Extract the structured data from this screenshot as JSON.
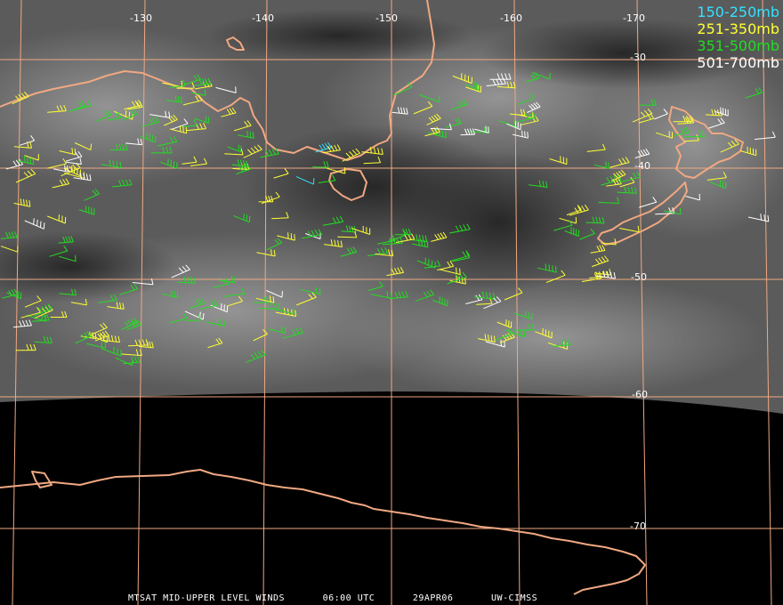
{
  "colors": {
    "graticule": "#f0a882",
    "coastline": "#f0a882",
    "background": "#000000",
    "imagery": "#5a5a5a"
  },
  "longitude_labels": [
    "-130",
    "-140",
    "-150",
    "-160",
    "-170"
  ],
  "latitude_labels": [
    "-30",
    "-40",
    "-50",
    "-60",
    "-70"
  ],
  "legend": [
    {
      "label": "150-250mb",
      "color": "#33e0ff"
    },
    {
      "label": "251-350mb",
      "color": "#ffff33"
    },
    {
      "label": "351-500mb",
      "color": "#22dd22"
    },
    {
      "label": "501-700mb",
      "color": "#ffffff"
    }
  ],
  "footer": {
    "product": "MTSAT MID-UPPER LEVEL WINDS",
    "time": "06:00 UTC",
    "date": "29APR06",
    "source": "UW-CIMSS"
  }
}
